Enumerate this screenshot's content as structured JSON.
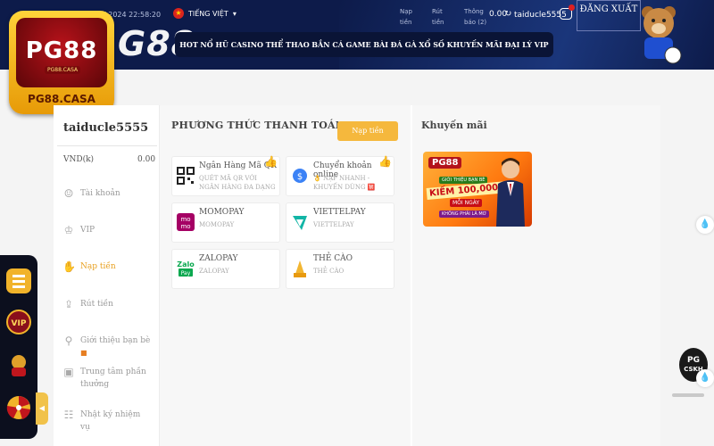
{
  "header": {
    "date": "/ 2024 22:58:20",
    "language": "TIẾNG VIỆT",
    "brand_text": "G88",
    "nav": [
      "HOT",
      "NỔ HŨ",
      "CASINO",
      "THỂ THAO",
      "BẮN CÁ",
      "GAME BÀI",
      "ĐÁ GÀ",
      "XỔ SỐ",
      "KHUYẾN MÃI",
      "ĐẠI LÝ",
      "VIP"
    ],
    "tools": [
      "Nạp tiền",
      "Rút tiền",
      "Thông báo (2)"
    ],
    "balance": "0.00",
    "username": "taiducle5555",
    "logout": "ĐĂNG XUẤT"
  },
  "logo": {
    "main": "PG88",
    "small": "PG88.CASA",
    "domain": "PG88.CASA"
  },
  "sidebar": {
    "username": "taiducle5555",
    "currency": "VND(k)",
    "amount": "0.00",
    "items": [
      {
        "label": "Tài khoản",
        "icon": "user-icon",
        "active": false
      },
      {
        "label": "VIP",
        "icon": "crown-icon",
        "active": false
      },
      {
        "label": "Nạp tiền",
        "icon": "deposit-hand-icon",
        "active": true
      },
      {
        "label": "Rút tiền",
        "icon": "withdraw-icon",
        "active": false
      },
      {
        "label": "Giới thiệu bạn bè",
        "icon": "referral-icon",
        "active": false
      },
      {
        "label": "Trung tâm phần thưởng",
        "icon": "gift-box-icon",
        "active": false
      },
      {
        "label": "Nhật ký nhiệm vụ",
        "icon": "task-log-icon",
        "active": false
      }
    ]
  },
  "payment": {
    "title": "PHƯƠNG THỨC THANH TOÁN",
    "deposit_button": "Nạp tiền",
    "methods": [
      {
        "name": "Ngân Hàng Mã QR",
        "sub": "QUÉT MÃ QR VỚI NGÂN HÀNG ĐA DẠNG",
        "icon": "qr-code-icon",
        "recommended": true
      },
      {
        "name": "Chuyển khoản online",
        "sub": "👌 NẠP NHANH - KHUYẾN DÙNG 🈲",
        "icon": "online-transfer-icon",
        "recommended": true
      },
      {
        "name": "MOMOPAY",
        "sub": "MOMOPAY",
        "icon": "momo-icon",
        "recommended": false
      },
      {
        "name": "VIETTELPAY",
        "sub": "VIETTELPAY",
        "icon": "viettelpay-icon",
        "recommended": false
      },
      {
        "name": "ZALOPAY",
        "sub": "ZALOPAY",
        "icon": "zalopay-icon",
        "recommended": false
      },
      {
        "name": "THẺ CÀO",
        "sub": "THẺ CÀO",
        "icon": "scratch-card-icon",
        "recommended": false
      }
    ]
  },
  "promotions": {
    "title": "Khuyến mãi",
    "banner": {
      "brand": "PG88",
      "tagline": "GIỚI THIỆU BẠN BÈ",
      "headline": "KIẾM 100,000K",
      "sub": "MỖI NGÀY",
      "note": "KHÔNG PHẢI LÀ MƠ"
    }
  },
  "right_float": {
    "support_top": "PG",
    "support_bottom": "CSKH"
  },
  "colors": {
    "header_bg": "#0d1b4a",
    "accent": "#f5b83d",
    "active_menu": "#e8a020"
  }
}
